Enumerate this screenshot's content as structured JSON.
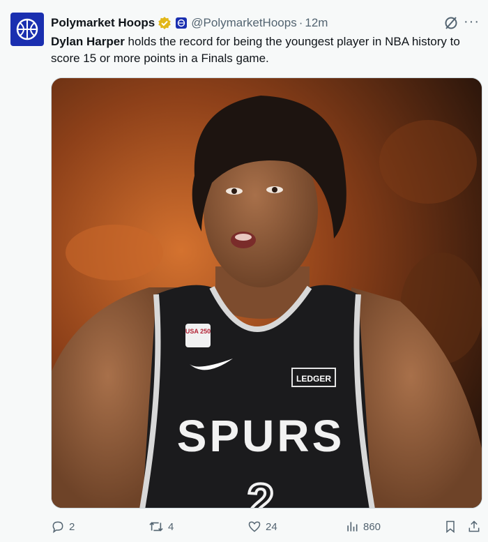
{
  "author": {
    "display_name": "Polymarket Hoops",
    "handle": "@PolymarketHoops",
    "time": "12m",
    "separator": "·"
  },
  "tweet": {
    "name_bold": "Dylan Harper",
    "text_rest": " holds the record for being the youngest player in NBA history to score 15 or more points in a Finals game."
  },
  "media": {
    "jersey_team_text": "SPURS",
    "jersey_sponsor": "LEDGER",
    "jersey_patch": "USA 250",
    "jersey_number": "2"
  },
  "actions": {
    "replies": "2",
    "reposts": "4",
    "likes": "24",
    "views": "860"
  },
  "colors": {
    "brand": "#1a2fb0",
    "verified": "#e2b719",
    "muted": "#536471"
  }
}
